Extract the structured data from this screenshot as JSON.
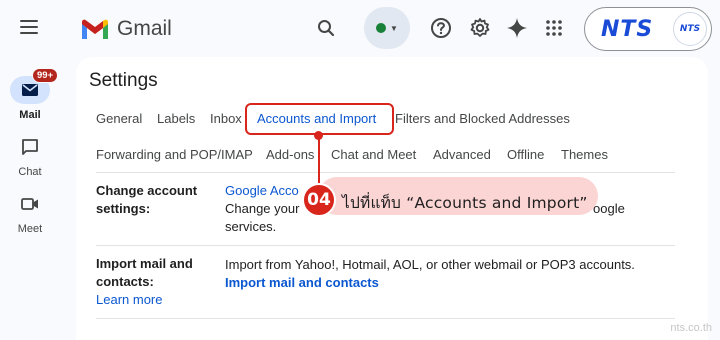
{
  "header": {
    "app_name": "Gmail",
    "status_color": "#188038",
    "account_logo": "NTS",
    "account_avatar_text": "NTS"
  },
  "rail": {
    "mail_label": "Mail",
    "mail_badge": "99+",
    "chat_label": "Chat",
    "meet_label": "Meet"
  },
  "page": {
    "title": "Settings"
  },
  "tabs": [
    {
      "label": "General"
    },
    {
      "label": "Labels"
    },
    {
      "label": "Inbox"
    },
    {
      "label": "Accounts and Import"
    },
    {
      "label": "Filters and Blocked Addresses"
    },
    {
      "label": "Forwarding and POP/IMAP"
    },
    {
      "label": "Add-ons"
    },
    {
      "label": "Chat and Meet"
    },
    {
      "label": "Advanced"
    },
    {
      "label": "Offline"
    },
    {
      "label": "Themes"
    }
  ],
  "rows": {
    "change_account": {
      "label_line1": "Change account",
      "label_line2": "settings:",
      "link": "Google Acco",
      "line2a": "Change your",
      "line2b": "oogle",
      "line3": "services."
    },
    "import_mail": {
      "label_line1": "Import mail and",
      "label_line2": "contacts:",
      "learn_more": "Learn more",
      "description": "Import from Yahoo!, Hotmail, AOL, or other webmail or POP3 accounts.",
      "action": "Import mail and contacts"
    }
  },
  "callout": {
    "step": "04",
    "text": "ไปที่แท็บ “Accounts and Import”"
  },
  "watermark": "nts.co.th"
}
